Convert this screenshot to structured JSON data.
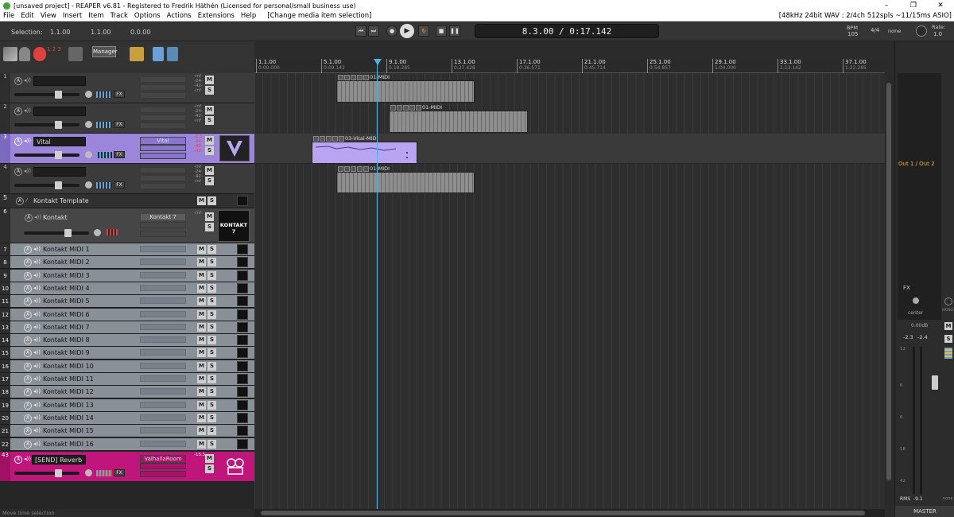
{
  "window": {
    "title": "[unsaved project] - REAPER v6.81 - Registered to Fredrik Häthén (Licensed for personal/small business use)",
    "minimize": "–",
    "maximize": "❐",
    "close": "✕"
  },
  "menu": {
    "items": [
      "File",
      "Edit",
      "View",
      "Insert",
      "Item",
      "Track",
      "Options",
      "Actions",
      "Extensions",
      "Help"
    ],
    "context": "[Change media item selection]",
    "audio_status": "[48kHz 24bit WAV : 2/4ch 512spls ~11/15ms ASIO]"
  },
  "transport": {
    "selection_label": "Selection:",
    "sel_start": "1.1.00",
    "sel_end": "1.1.00",
    "sel_len": "0.0.00",
    "time": "8.3.00 / 0:17.142",
    "bpm_label": "BPM",
    "bpm": "105",
    "timesig": "4/4",
    "none": "none",
    "rate_label": "Rate:",
    "rate": "1.0",
    "manager": "Manager",
    "num": "1 2 3"
  },
  "ruler": [
    {
      "bar": "1.1.00",
      "time": "0:00.000"
    },
    {
      "bar": "5.1.00",
      "time": "0:09.142"
    },
    {
      "bar": "9.1.00",
      "time": "0:18.285"
    },
    {
      "bar": "13.1.00",
      "time": "0:27.428"
    },
    {
      "bar": "17.1.00",
      "time": "0:36.571"
    },
    {
      "bar": "21.1.00",
      "time": "0:45.714"
    },
    {
      "bar": "25.1.00",
      "time": "0:54.857"
    },
    {
      "bar": "29.1.00",
      "time": "1:04.000"
    },
    {
      "bar": "33.1.00",
      "time": "1:13.142"
    },
    {
      "bar": "37.1.00",
      "time": "1:22.285"
    }
  ],
  "tracks": {
    "t1": {
      "num": "1",
      "name": "",
      "vol_top": "-inf",
      "vol_a": "-24-",
      "vol_b": "-42-",
      "vol_c": "-inf"
    },
    "t2": {
      "num": "2",
      "name": "",
      "vol_top": "-inf",
      "vol_a": "-24-",
      "vol_b": "-42-",
      "vol_c": "-inf"
    },
    "t3": {
      "num": "3",
      "name": "Vital",
      "fx": "Vital",
      "vol_top": "-1.3",
      "vol_a": "-24-",
      "vol_b": "-42-",
      "vol_c": "-inf"
    },
    "t4": {
      "num": "4",
      "name": "",
      "vol_top": "-inf",
      "vol_a": "-24-",
      "vol_b": "-42-",
      "vol_c": "-inf"
    },
    "t5": {
      "num": "5",
      "name": "Kontakt Template"
    },
    "t6": {
      "num": "6",
      "name": "Kontakt",
      "fx": "Kontakt 7",
      "vol_top": "-inf",
      "logo": "KONTAKT 7"
    },
    "kontakt_midi": [
      {
        "num": "7",
        "name": "Kontakt MIDI 1"
      },
      {
        "num": "8",
        "name": "Kontakt MIDI 2"
      },
      {
        "num": "9",
        "name": "Kontakt MIDI 3"
      },
      {
        "num": "10",
        "name": "Kontakt MIDI 4"
      },
      {
        "num": "11",
        "name": "Kontakt MIDI 5"
      },
      {
        "num": "12",
        "name": "Kontakt MIDI 6"
      },
      {
        "num": "13",
        "name": "Kontakt MIDI 7"
      },
      {
        "num": "14",
        "name": "Kontakt MIDI 8"
      },
      {
        "num": "15",
        "name": "Kontakt MIDI 9"
      },
      {
        "num": "16",
        "name": "Kontakt MIDI 10"
      },
      {
        "num": "17",
        "name": "Kontakt MIDI 11"
      },
      {
        "num": "18",
        "name": "Kontakt MIDI 12"
      },
      {
        "num": "19",
        "name": "Kontakt MIDI 13"
      },
      {
        "num": "20",
        "name": "Kontakt MIDI 14"
      },
      {
        "num": "21",
        "name": "Kontakt MIDI 15"
      },
      {
        "num": "22",
        "name": "Kontakt MIDI 16"
      }
    ],
    "send": {
      "num": "43",
      "name": "[SEND] Reverb",
      "fx": "ValhallaRoom",
      "vol_top": "-15.5"
    }
  },
  "labels": {
    "m": "M",
    "s": "S",
    "fx": "FX",
    "a": "A",
    "spk": "◂))"
  },
  "items": {
    "i1": "01-MIDI",
    "i2": "01-MIDI",
    "i3": "03-Vital-MIDI",
    "i4": "01-MIDI"
  },
  "mixer": {
    "out": "Out 1 / Out 2",
    "fx": "FX",
    "center": "center",
    "db": "0.00dB",
    "pk_l": "-2.3",
    "pk_r": "-2.4",
    "rms_label": "RMS",
    "rms": "-9.1",
    "master": "MASTER",
    "mono": "MONO",
    "none": "none"
  },
  "status": "Move time selection",
  "colors": {
    "vital": "#a48be6",
    "send": "#c0157a",
    "cursor": "#4ab4e8",
    "accent": "#f0b040"
  }
}
